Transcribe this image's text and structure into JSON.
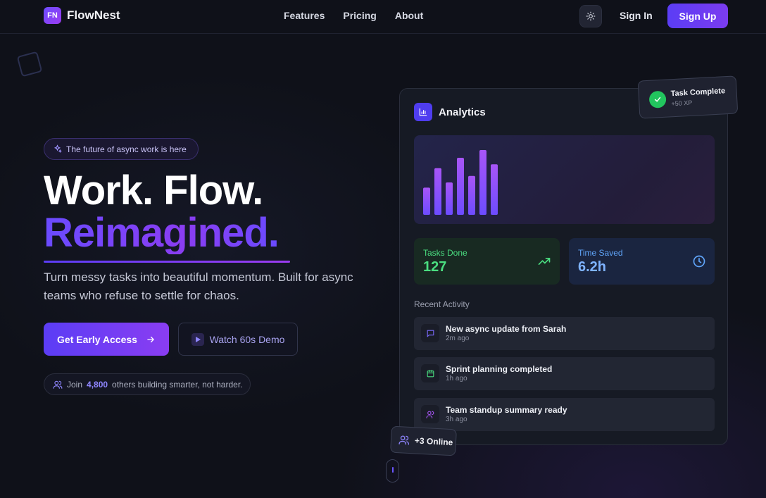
{
  "nav": {
    "logo_mark": "FN",
    "logo_text": "FlowNest",
    "links": [
      "Features",
      "Pricing",
      "About"
    ],
    "signin": "Sign In",
    "signup": "Sign Up"
  },
  "hero": {
    "badge": "The future of async work is here",
    "title_line1": "Work. Flow.",
    "title_line2": "Reimagined.",
    "subtitle": "Turn messy tasks into beautiful momentum. Built for async teams who refuse to settle for chaos.",
    "cta": "Get Early Access",
    "demo": "Watch 60s Demo",
    "social_pre": "Join",
    "social_count": "4,800",
    "social_post": "others building smarter, not harder."
  },
  "dashboard": {
    "title": "Analytics",
    "bars": [
      0.42,
      0.72,
      0.5,
      0.88,
      0.6,
      1.0,
      0.78
    ],
    "stats": [
      {
        "label": "Tasks Done",
        "value": "127"
      },
      {
        "label": "Time Saved",
        "value": "6.2h"
      }
    ],
    "recent_heading": "Recent Activity",
    "activity": [
      {
        "title": "New async update from Sarah",
        "time": "2m ago"
      },
      {
        "title": "Sprint planning completed",
        "time": "1h ago"
      },
      {
        "title": "Team standup summary ready",
        "time": "3h ago"
      }
    ]
  },
  "toast": {
    "title": "Task Complete",
    "sub": "+50 XP"
  },
  "online": {
    "label": "+3 Online"
  },
  "colors": {
    "accent": "#5b3df5",
    "accent2": "#8a3df2",
    "green": "#4ade80",
    "blue": "#60a5fa"
  }
}
